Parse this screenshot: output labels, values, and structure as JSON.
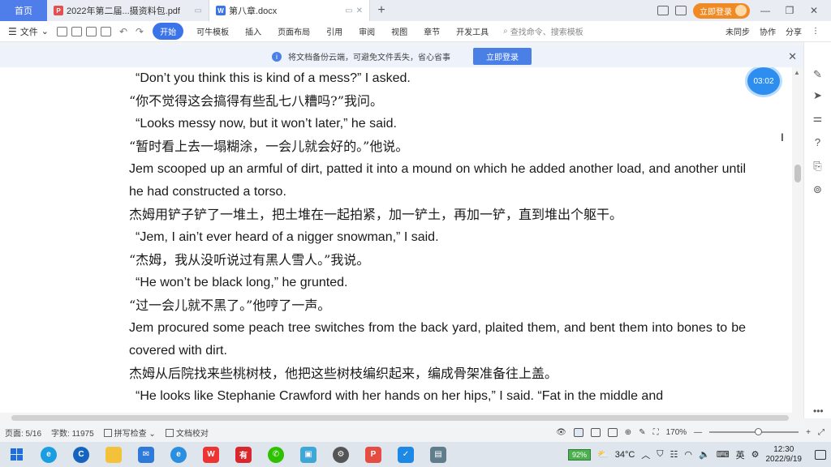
{
  "titlebar": {
    "home_tab": "首页",
    "tabs": [
      {
        "label": "2022年第二届...摄资料包.pdf",
        "icon": "pdf-icon"
      },
      {
        "label": "第八章.docx",
        "icon": "word-icon"
      }
    ],
    "login_button": "立即登录"
  },
  "ribbon": {
    "file_menu": "文件",
    "menus": [
      "开始",
      "可牛模板",
      "插入",
      "页面布局",
      "引用",
      "审阅",
      "视图",
      "章节",
      "开发工具"
    ],
    "search_placeholder": "查找命令、搜索模板",
    "sync": "未同步",
    "collab": "协作",
    "share": "分享"
  },
  "notice": {
    "text": "将文档备份云端，可避免文件丢失，省心省事",
    "button": "立即登录"
  },
  "timer": "03:02",
  "document": {
    "paragraphs": [
      {
        "lang": "en",
        "indent": true,
        "text": "“Don’t you think this is kind of a mess?”  I asked."
      },
      {
        "lang": "zh",
        "indent": false,
        "text": "“你不觉得这会搞得有些乱七八糟吗?”我问。"
      },
      {
        "lang": "en",
        "indent": true,
        "text": "“Looks messy now, but it won’t later,”  he said."
      },
      {
        "lang": "zh",
        "indent": false,
        "text": "“暂时看上去一塌糊涂，一会儿就会好的。”他说。"
      },
      {
        "lang": "en",
        "indent": false,
        "wrap": true,
        "text": "Jem scooped up an armful of dirt, patted it into a mound on which he added another load, and another until he had constructed a torso."
      },
      {
        "lang": "zh",
        "indent": false,
        "text": "杰姆用铲子铲了一堆土，把土堆在一起拍紧，加一铲土，再加一铲，直到堆出个躯干。"
      },
      {
        "lang": "en",
        "indent": true,
        "text": "“Jem, I ain’t ever heard of a nigger snowman,”  I said."
      },
      {
        "lang": "zh",
        "indent": false,
        "text": "“杰姆，我从没听说过有黑人雪人。”我说。"
      },
      {
        "lang": "en",
        "indent": true,
        "text": "“He won’t be black long,”  he grunted."
      },
      {
        "lang": "zh",
        "indent": false,
        "text": "“过一会儿就不黑了。”他哼了一声。"
      },
      {
        "lang": "en",
        "indent": false,
        "wrap": true,
        "text": "Jem procured some peach tree switches from the back yard, plaited them, and bent them into bones to be covered with dirt."
      },
      {
        "lang": "zh",
        "indent": false,
        "text": "杰姆从后院找来些桃树枝，他把这些树枝编织起来，编成骨架准备往上盖。"
      },
      {
        "lang": "en",
        "indent": true,
        "text": "“He looks like Stephanie Crawford with her hands on her hips,”  I said.  “Fat in the middle and"
      }
    ]
  },
  "statusbar": {
    "page": "页面: 5/16",
    "word_count": "字数: 11975",
    "spell_check": "拼写检查",
    "doc_check": "文档校对",
    "zoom": "170%"
  },
  "taskbar": {
    "battery": "92%",
    "weather": "34°C",
    "ime": "英",
    "time": "12:30",
    "date": "2022/9/19"
  },
  "colors": {
    "accent": "#3b74e8",
    "login": "#f08a24",
    "timer": "#2d8ef0"
  }
}
